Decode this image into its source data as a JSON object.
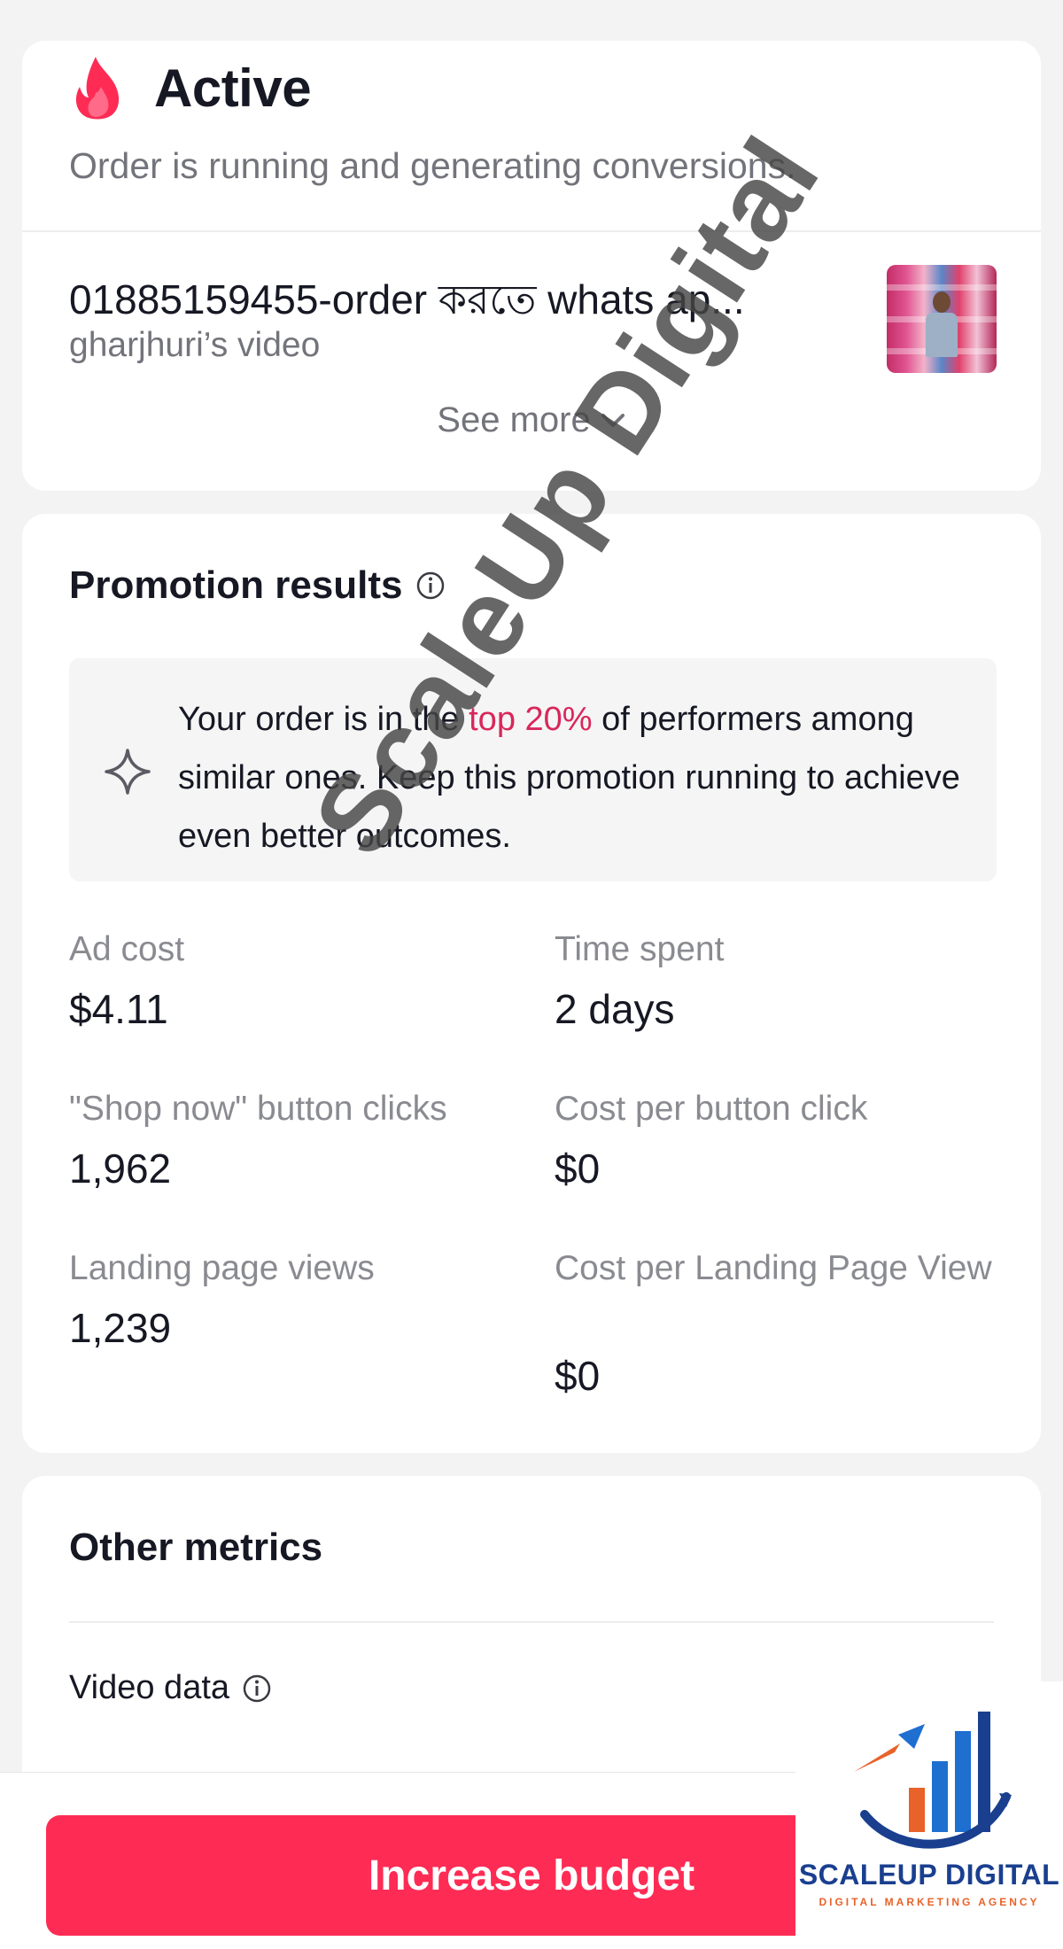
{
  "status": {
    "title": "Active",
    "description": "Order is running and generating conversions.",
    "icon": "flame-icon",
    "icon_color": "#fe2c55"
  },
  "order": {
    "title": "01885159455-order করতে whats ap...",
    "subtitle": "gharjhuri’s video",
    "see_more_label": "See more"
  },
  "promotion_results": {
    "title": "Promotion results",
    "tip_prefix": "Your order is in the ",
    "tip_highlight": "top 20%",
    "tip_suffix": " of performers among similar ones. Keep this promotion running to achieve even better outcomes.",
    "highlight_color": "#d9275a",
    "metrics": [
      {
        "label": "Ad cost",
        "value": "$4.11"
      },
      {
        "label": "Time spent",
        "value": "2 days"
      },
      {
        "label": "\"Shop now\" button clicks",
        "value": "1,962"
      },
      {
        "label": "Cost per button click",
        "value": "$0"
      },
      {
        "label": "Landing page views",
        "value": "1,239"
      },
      {
        "label": "Cost per Landing Page View",
        "value": "$0"
      }
    ]
  },
  "other_metrics": {
    "title": "Other metrics",
    "video_data_label": "Video data"
  },
  "cta": {
    "label": "Increase budget",
    "color": "#fe2c55"
  },
  "watermark": {
    "text": "ScaleUp Digital"
  },
  "brand": {
    "name": "SCALEUP DIGITAL",
    "tagline": "DIGITAL MARKETING AGENCY"
  }
}
